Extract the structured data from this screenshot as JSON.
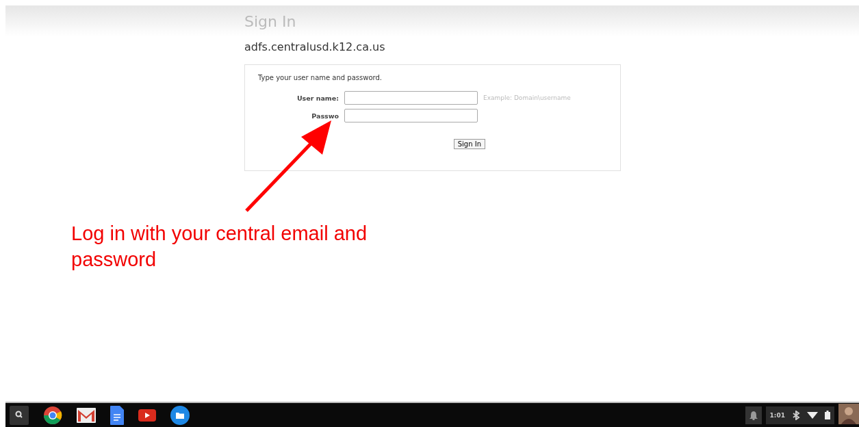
{
  "page": {
    "title": "Sign In",
    "host": "adfs.centralusd.k12.ca.us"
  },
  "form": {
    "intro": "Type your user name and password.",
    "fields": [
      {
        "label": "User name:",
        "hint": "Example: Domain\\username"
      },
      {
        "label": "Passwo"
      }
    ],
    "button": "Sign In"
  },
  "annotation": "Log in with your central email and password",
  "taskbar": {
    "apps": [
      {
        "kind": "search"
      },
      {
        "kind": "chrome"
      },
      {
        "kind": "mail"
      },
      {
        "kind": "docs"
      },
      {
        "kind": "video"
      },
      {
        "kind": "files"
      }
    ],
    "time": "1:01"
  }
}
